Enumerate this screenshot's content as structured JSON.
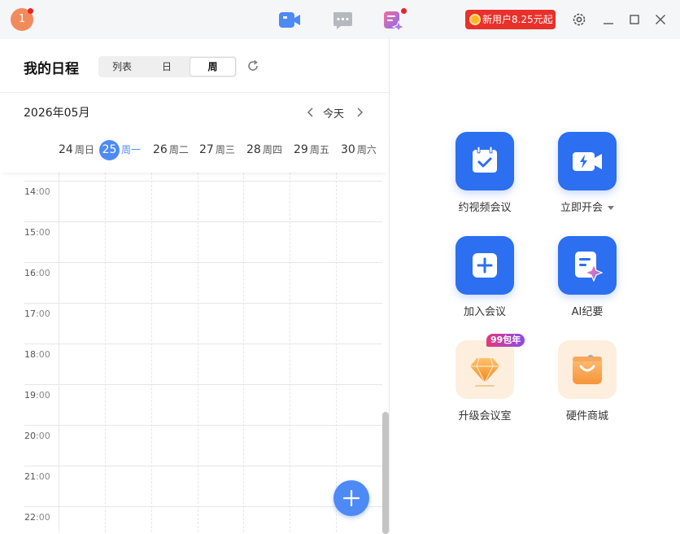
{
  "topbar": {
    "avatar_initial": "1",
    "promo_label": "新用户8.25元起"
  },
  "schedule": {
    "title": "我的日程",
    "view_tabs": [
      {
        "label": "列表",
        "active": false
      },
      {
        "label": "日",
        "active": false
      },
      {
        "label": "周",
        "active": true
      }
    ],
    "month": "2026年05月",
    "today_label": "今天",
    "days": [
      {
        "date": "24",
        "weekday": "周日",
        "current": false
      },
      {
        "date": "25",
        "weekday": "周一",
        "current": true
      },
      {
        "date": "26",
        "weekday": "周二",
        "current": false
      },
      {
        "date": "27",
        "weekday": "周三",
        "current": false
      },
      {
        "date": "28",
        "weekday": "周四",
        "current": false
      },
      {
        "date": "29",
        "weekday": "周五",
        "current": false
      },
      {
        "date": "30",
        "weekday": "周六",
        "current": false
      }
    ],
    "hours": [
      {
        "h": "14",
        "m": "00"
      },
      {
        "h": "15",
        "m": "00"
      },
      {
        "h": "16",
        "m": "00"
      },
      {
        "h": "17",
        "m": "00"
      },
      {
        "h": "18",
        "m": "00"
      },
      {
        "h": "19",
        "m": "00"
      },
      {
        "h": "20",
        "m": "00"
      },
      {
        "h": "21",
        "m": "00"
      },
      {
        "h": "22",
        "m": "00"
      }
    ],
    "hour_separator": ":"
  },
  "actions": [
    {
      "label": "约视频会议",
      "icon": "calendar-check-icon"
    },
    {
      "label": "立即开会",
      "icon": "video-flash-icon"
    },
    {
      "label": "加入会议",
      "icon": "plus-square-icon"
    },
    {
      "label": "AI纪要",
      "icon": "ai-notes-icon"
    },
    {
      "label": "升级会议室",
      "icon": "diamond-icon"
    },
    {
      "label": "硬件商城",
      "icon": "shopping-bag-icon"
    }
  ],
  "upgrade_badge": "99包年",
  "colors": {
    "accent": "#4e8af5",
    "tile_blue": "#2c6ff0",
    "promo_red": "#e9302a",
    "notification_red": "#e8242a"
  }
}
